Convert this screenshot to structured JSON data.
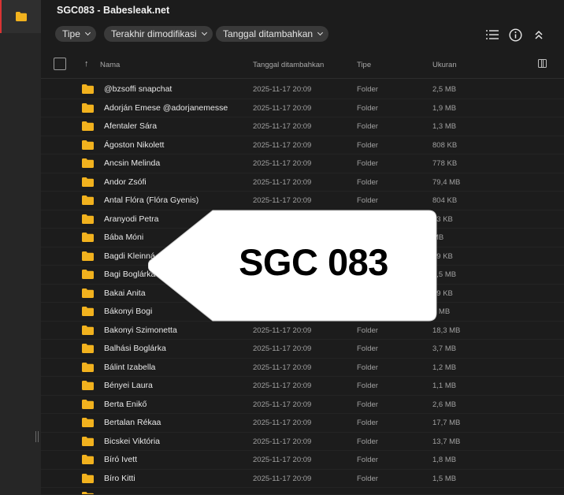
{
  "sidebar": {
    "active_icon": "folder-icon",
    "accent_color": "#d93434"
  },
  "header": {
    "title": "SGC083 - Babesleak.net"
  },
  "filters": [
    {
      "label": "Tipe"
    },
    {
      "label": "Terakhir dimodifikasi"
    },
    {
      "label": "Tanggal ditambahkan"
    }
  ],
  "toolbar": {
    "icons": [
      "list-view-icon",
      "info-icon",
      "collapse-icon"
    ]
  },
  "table": {
    "columns": {
      "name": "Nama",
      "date": "Tanggal ditambahkan",
      "type": "Tipe",
      "size": "Ukuran"
    },
    "folder_color": "#f2b21e",
    "rows": [
      {
        "name": "@bzsoffi snapchat",
        "date": "2025-11-17 20:09",
        "type": "Folder",
        "size": "2,5 MB"
      },
      {
        "name": "Adorján Emese @adorjanemesse",
        "date": "2025-11-17 20:09",
        "type": "Folder",
        "size": "1,9 MB"
      },
      {
        "name": "Afentaler Sára",
        "date": "2025-11-17 20:09",
        "type": "Folder",
        "size": "1,3 MB"
      },
      {
        "name": "Ágoston Nikolett",
        "date": "2025-11-17 20:09",
        "type": "Folder",
        "size": "808 KB"
      },
      {
        "name": "Ancsin Melinda",
        "date": "2025-11-17 20:09",
        "type": "Folder",
        "size": "778 KB"
      },
      {
        "name": "Andor Zsófi",
        "date": "2025-11-17 20:09",
        "type": "Folder",
        "size": "79,4 MB"
      },
      {
        "name": "Antal Flóra (Flóra Gyenis)",
        "date": "2025-11-17 20:09",
        "type": "Folder",
        "size": "804 KB"
      },
      {
        "name": "Aranyodi Petra",
        "date": "",
        "type": "",
        "size": "93 KB"
      },
      {
        "name": "Bába Móni",
        "date": "",
        "type": "",
        "size": "MB"
      },
      {
        "name": "Bagdi Kleinná",
        "date": "",
        "type": "",
        "size": "79 KB"
      },
      {
        "name": "Bagi Boglárka",
        "date": "",
        "type": "",
        "size": "9,5 MB"
      },
      {
        "name": "Bakai Anita",
        "date": "",
        "type": "",
        "size": "79 KB"
      },
      {
        "name": "Bákonyi Bogi",
        "date": "",
        "type": "",
        "size": "5 MB"
      },
      {
        "name": "Bakonyi Szimonetta",
        "date": "2025-11-17 20:09",
        "type": "Folder",
        "size": "18,3 MB"
      },
      {
        "name": "Balhási Boglárka",
        "date": "2025-11-17 20:09",
        "type": "Folder",
        "size": "3,7 MB"
      },
      {
        "name": "Bálint Izabella",
        "date": "2025-11-17 20:09",
        "type": "Folder",
        "size": "1,2 MB"
      },
      {
        "name": "Bényei Laura",
        "date": "2025-11-17 20:09",
        "type": "Folder",
        "size": "1,1 MB"
      },
      {
        "name": "Berta Enikő",
        "date": "2025-11-17 20:09",
        "type": "Folder",
        "size": "2,6 MB"
      },
      {
        "name": "Bertalan Rékaa",
        "date": "2025-11-17 20:09",
        "type": "Folder",
        "size": "17,7 MB"
      },
      {
        "name": "Bicskei Viktória",
        "date": "2025-11-17 20:09",
        "type": "Folder",
        "size": "13,7 MB"
      },
      {
        "name": "Bíró Ivett",
        "date": "2025-11-17 20:09",
        "type": "Folder",
        "size": "1,8 MB"
      },
      {
        "name": "Bíro Kitti",
        "date": "2025-11-17 20:09",
        "type": "Folder",
        "size": "1,5 MB"
      }
    ]
  },
  "overlay": {
    "label": "SGC 083"
  }
}
